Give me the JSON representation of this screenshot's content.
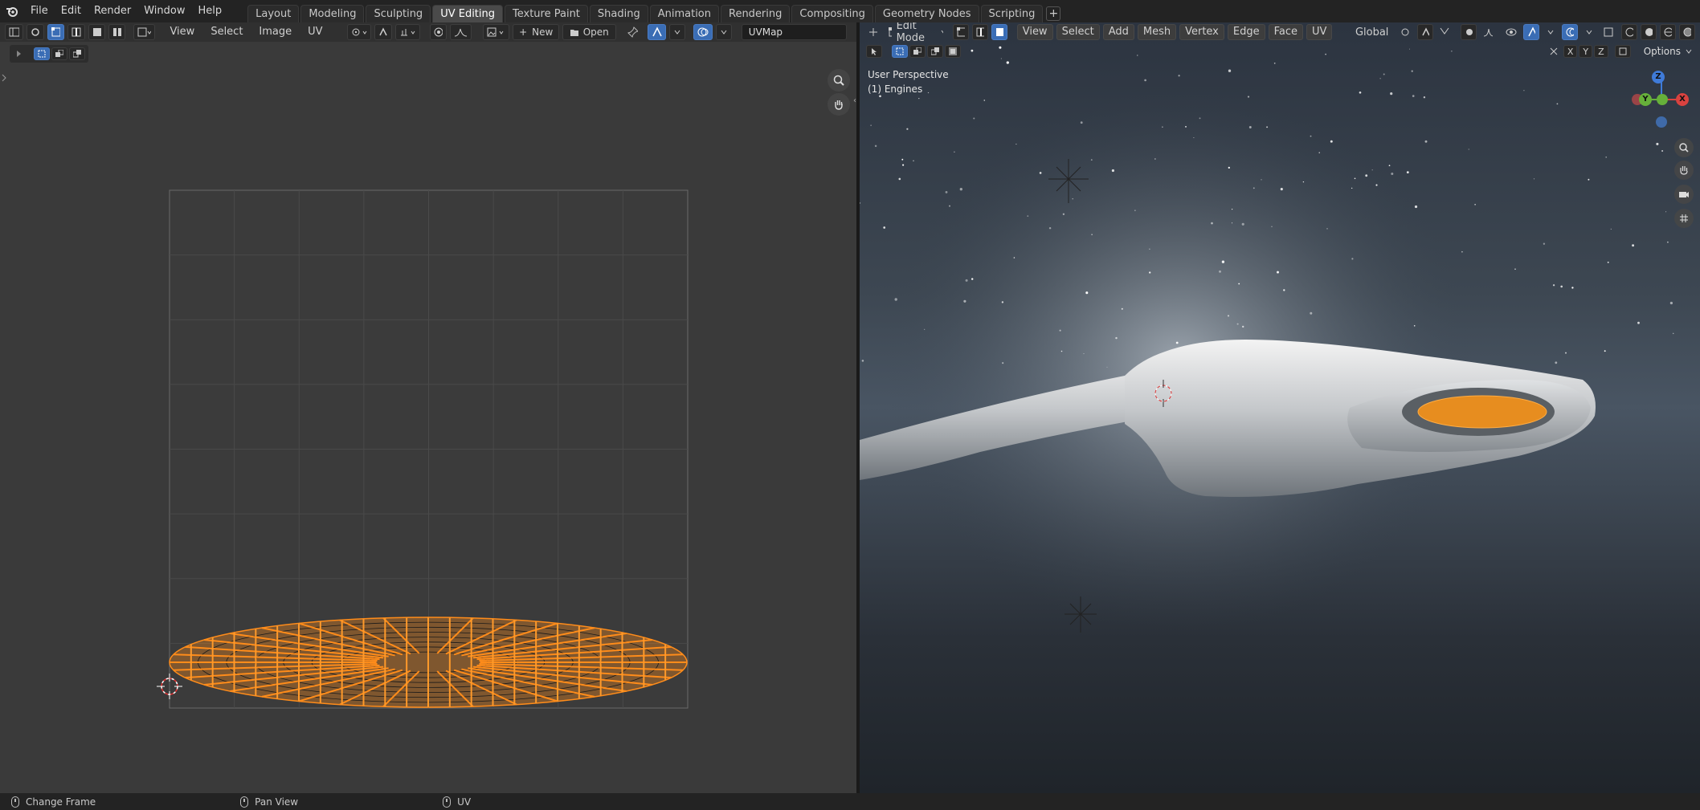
{
  "app": {
    "menu": [
      "File",
      "Edit",
      "Render",
      "Window",
      "Help"
    ]
  },
  "workspaces": {
    "tabs": [
      "Layout",
      "Modeling",
      "Sculpting",
      "UV Editing",
      "Texture Paint",
      "Shading",
      "Animation",
      "Rendering",
      "Compositing",
      "Geometry Nodes",
      "Scripting"
    ],
    "active": "UV Editing",
    "add_label": "+"
  },
  "uv_editor": {
    "menus": [
      "View",
      "Select",
      "Image",
      "UV"
    ],
    "new_label": "New",
    "open_label": "Open",
    "uv_map": "UVMap",
    "accent": "#ff8c1a"
  },
  "viewport": {
    "mode": "Edit Mode",
    "menus": [
      "View",
      "Select",
      "Add",
      "Mesh",
      "Vertex",
      "Edge",
      "Face",
      "UV"
    ],
    "orientation": "Global",
    "options_label": "Options",
    "xyz": [
      "X",
      "Y",
      "Z"
    ],
    "perspective": "User Perspective",
    "object": "(1) Engines",
    "gizmo_axes": [
      "Z",
      "Y",
      "X"
    ]
  },
  "status": {
    "items": [
      "Change Frame",
      "Pan View",
      "UV"
    ]
  },
  "icons": [
    "blender-logo-icon",
    "editor-type-icon",
    "sync-icon",
    "vertex-select-icon",
    "edge-select-icon",
    "face-select-icon",
    "island-select-icon",
    "pivot-icon",
    "snap-icon",
    "proportional-icon",
    "image-icon",
    "new-plus-icon",
    "folder-icon",
    "pin-icon",
    "overlay-icon",
    "zoom-icon",
    "hand-icon",
    "camera-icon",
    "grid-icon",
    "cursor-icon",
    "mouse-icon"
  ]
}
